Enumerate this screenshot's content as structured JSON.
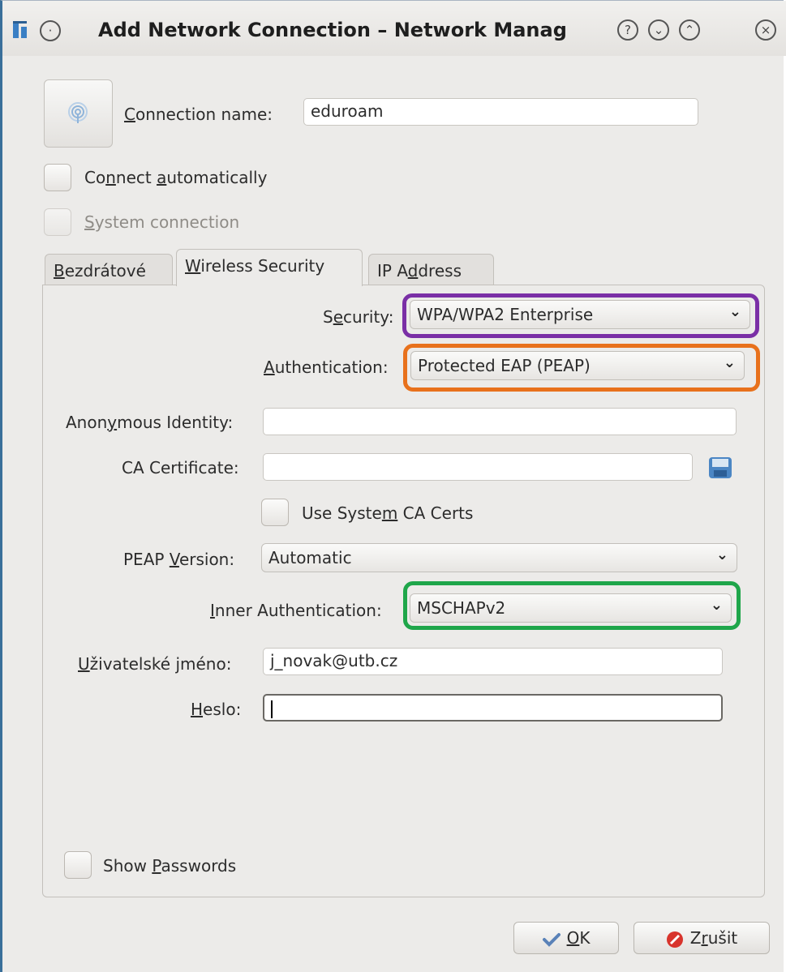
{
  "window": {
    "title": "Add Network Connection – Network Manag",
    "buttons": [
      "help",
      "minimize",
      "maximize",
      "close"
    ]
  },
  "connection": {
    "name_label_pre": "",
    "name_label_mn": "C",
    "name_label_post": "onnection name:",
    "name_value": "eduroam"
  },
  "checks": {
    "auto_pre": "Co",
    "auto_mn1": "n",
    "auto_mid": "nect ",
    "auto_mn2": "a",
    "auto_post": "utomatically",
    "system_mn": "S",
    "system_post": "ystem connection"
  },
  "tabs": [
    {
      "mn": "B",
      "post": "ezdrátové"
    },
    {
      "mn": "W",
      "post": "ireless Security"
    },
    {
      "pre": "IP A",
      "mn": "d",
      "post": "dress"
    }
  ],
  "security": {
    "security_label_pre": "S",
    "security_label_mn": "e",
    "security_label_post": "curity:",
    "security_value": "WPA/WPA2 Enterprise",
    "auth_label_mn": "A",
    "auth_label_post": "uthentication:",
    "auth_value": "Protected EAP (PEAP)",
    "anon_label_pre": "Anon",
    "anon_label_mn": "y",
    "anon_label_post": "mous Identity:",
    "anon_value": "",
    "ca_label": "CA Certificate:",
    "ca_value": "",
    "use_ca_pre": "Use Syste",
    "use_ca_mn": "m",
    "use_ca_post": " CA Certs",
    "peap_label_pre": "PEAP ",
    "peap_label_mn": "V",
    "peap_label_post": "ersion:",
    "peap_value": "Automatic",
    "inner_label_mn": "I",
    "inner_label_post": "nner Authentication:",
    "inner_value": "MSCHAPv2",
    "user_label_mn": "U",
    "user_label_post": "živatelské jméno:",
    "user_value": "j_novak@utb.cz",
    "pass_label_mn": "H",
    "pass_label_post": "eslo:",
    "pass_value": "",
    "show_pw_pre": "Show ",
    "show_pw_mn": "P",
    "show_pw_post": "asswords"
  },
  "highlights": {
    "security_color": "#7a2fa6",
    "auth_color": "#e8711c",
    "inner_color": "#1fa64a"
  },
  "buttons": {
    "ok_mn": "O",
    "ok_post": "K",
    "cancel_pre": "Z",
    "cancel_mn": "r",
    "cancel_post": "ušit"
  }
}
